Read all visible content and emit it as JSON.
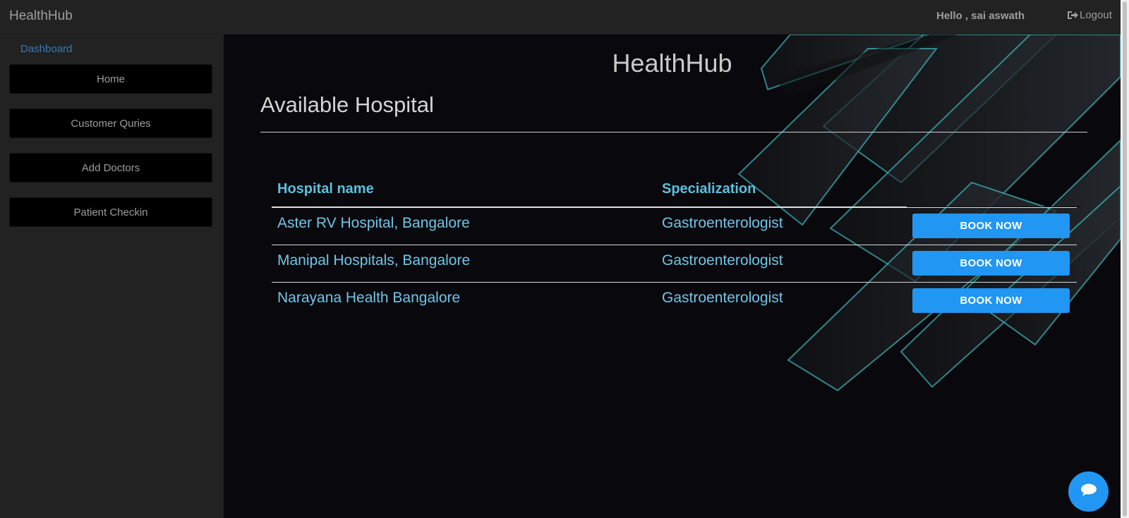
{
  "topbar": {
    "brand": "HealthHub",
    "greeting": "Hello , sai aswath",
    "logout_label": "Logout"
  },
  "sidebar": {
    "dashboard_label": "Dashboard",
    "items": [
      {
        "label": "Home"
      },
      {
        "label": "Customer Quries"
      },
      {
        "label": "Add Doctors"
      },
      {
        "label": "Patient Checkin"
      }
    ]
  },
  "main": {
    "app_title": "HealthHub",
    "heading": "Available Hospital",
    "table": {
      "columns": [
        "Hospital name",
        "Specialization"
      ],
      "rows": [
        {
          "hospital": "Aster RV Hospital, Bangalore",
          "specialization": "Gastroenterologist",
          "action": "BOOK NOW"
        },
        {
          "hospital": "Manipal Hospitals, Bangalore",
          "specialization": "Gastroenterologist",
          "action": "BOOK NOW"
        },
        {
          "hospital": "Narayana Health Bangalore",
          "specialization": "Gastroenterologist",
          "action": "BOOK NOW"
        }
      ]
    }
  },
  "colors": {
    "accent": "#2196f3",
    "link": "#337ab7",
    "table_text": "#6ec6e8",
    "background": "#09080c"
  },
  "icons": {
    "logout": "logout-icon",
    "chat": "chat-bubble-icon"
  }
}
